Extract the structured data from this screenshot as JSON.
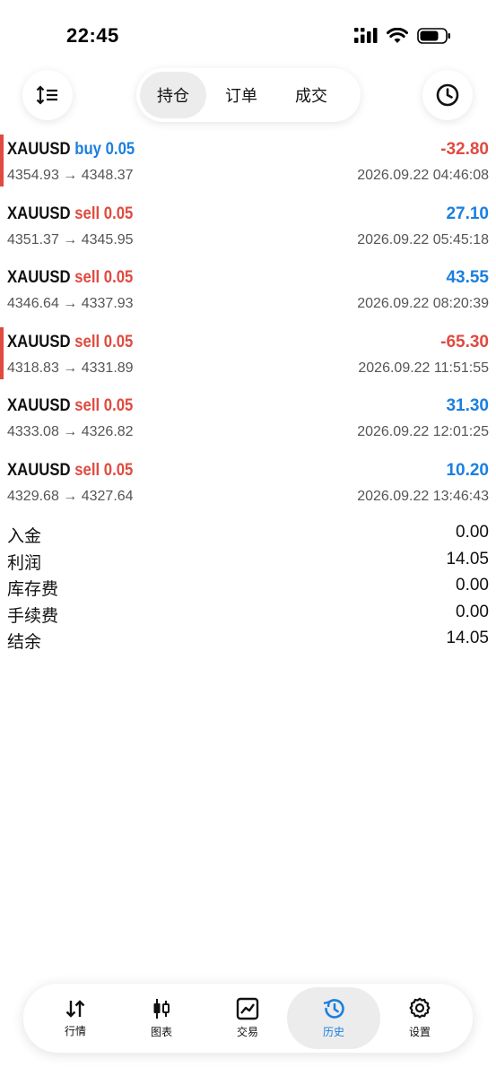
{
  "status_bar": {
    "time": "22:45"
  },
  "toolbar": {
    "tabs": [
      {
        "label": "持仓",
        "active": true
      },
      {
        "label": "订单",
        "active": false
      },
      {
        "label": "成交",
        "active": false
      }
    ]
  },
  "trades": [
    {
      "symbol": "XAUUSD",
      "side": "buy",
      "volume": "0.05",
      "profit": "-32.80",
      "prices": "4354.93 → 4348.37",
      "time": "2026.09.22 04:46:08"
    },
    {
      "symbol": "XAUUSD",
      "side": "sell",
      "volume": "0.05",
      "profit": "27.10",
      "prices": "4351.37 → 4345.95",
      "time": "2026.09.22 05:45:18"
    },
    {
      "symbol": "XAUUSD",
      "side": "sell",
      "volume": "0.05",
      "profit": "43.55",
      "prices": "4346.64 → 4337.93",
      "time": "2026.09.22 08:20:39"
    },
    {
      "symbol": "XAUUSD",
      "side": "sell",
      "volume": "0.05",
      "profit": "-65.30",
      "prices": "4318.83 → 4331.89",
      "time": "2026.09.22 11:51:55"
    },
    {
      "symbol": "XAUUSD",
      "side": "sell",
      "volume": "0.05",
      "profit": "31.30",
      "prices": "4333.08 → 4326.82",
      "time": "2026.09.22 12:01:25"
    },
    {
      "symbol": "XAUUSD",
      "side": "sell",
      "volume": "0.05",
      "profit": "10.20",
      "prices": "4329.68 → 4327.64",
      "time": "2026.09.22 13:46:43"
    }
  ],
  "summary": [
    {
      "label": "入金",
      "value": "0.00"
    },
    {
      "label": "利润",
      "value": "14.05"
    },
    {
      "label": "库存费",
      "value": "0.00"
    },
    {
      "label": "手续费",
      "value": "0.00"
    },
    {
      "label": "结余",
      "value": "14.05"
    }
  ],
  "bottom_nav": [
    {
      "label": "行情",
      "icon": "quotes-icon",
      "active": false
    },
    {
      "label": "图表",
      "icon": "chart-icon",
      "active": false
    },
    {
      "label": "交易",
      "icon": "trade-icon",
      "active": false
    },
    {
      "label": "历史",
      "icon": "history-icon",
      "active": true
    },
    {
      "label": "设置",
      "icon": "gear-icon",
      "active": false
    }
  ],
  "colors": {
    "buy": "#1a7fe0",
    "sell": "#e04a3f",
    "accent": "#1a7fe0"
  }
}
